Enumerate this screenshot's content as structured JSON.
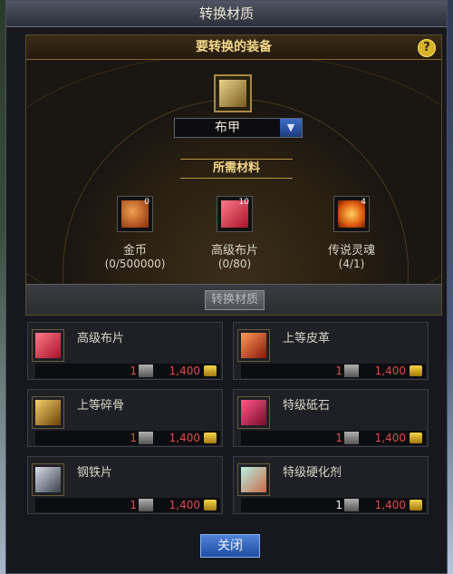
{
  "window": {
    "title": "转换材质"
  },
  "equipment": {
    "header": "要转换的装备",
    "help": "?",
    "selected": "布甲",
    "needed_label": "所需材料"
  },
  "materials": [
    {
      "name": "金币",
      "qty": "(0/500000)",
      "count": "0",
      "icon": "gold-ore-icon",
      "color": "#c85a1a"
    },
    {
      "name": "高级布片",
      "qty": "(0/80)",
      "count": "10",
      "icon": "cloth-icon",
      "color": "#d8324a"
    },
    {
      "name": "传说灵魂",
      "qty": "(4/1)",
      "count": "4",
      "icon": "soul-icon",
      "color": "#e86a14"
    }
  ],
  "convert_button": "转换材质",
  "recipes": [
    {
      "name": "高级布片",
      "count": "1",
      "cost": "1,400",
      "icon": "cloth-icon",
      "color": "#d8324a"
    },
    {
      "name": "上等皮革",
      "count": "1",
      "cost": "1,400",
      "icon": "leather-icon",
      "color": "#b8281a"
    },
    {
      "name": "上等碎骨",
      "count": "1",
      "cost": "1,400",
      "icon": "bone-icon",
      "color": "#c8902a"
    },
    {
      "name": "特级砥石",
      "count": "1",
      "cost": "1,400",
      "icon": "whetstone-icon",
      "color": "#c81c3c"
    },
    {
      "name": "钢铁片",
      "count": "1",
      "cost": "1,400",
      "icon": "steel-icon",
      "color": "#8a8f9a"
    },
    {
      "name": "特级硬化剂",
      "count": "1",
      "cost": "1,400",
      "icon": "hardener-icon",
      "color": "#6ab0a8"
    }
  ],
  "close_button": "关闭"
}
